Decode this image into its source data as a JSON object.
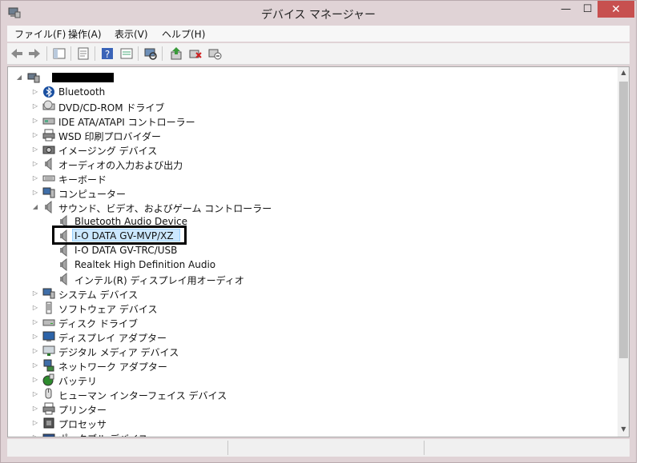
{
  "window": {
    "title": "デバイス マネージャー",
    "min_glyph": "—",
    "max_glyph": "☐",
    "close_glyph": "✕"
  },
  "menu": [
    {
      "label": "ファイル(F)"
    },
    {
      "label": "操作(A)"
    },
    {
      "label": "表示(V)"
    },
    {
      "label": "ヘルプ(H)"
    }
  ],
  "toolbar": [
    "back-icon",
    "forward-icon",
    "show-hide-tree-icon",
    "properties-icon",
    "help-icon",
    "view-icon",
    "scan-hardware-icon",
    "update-driver-icon",
    "uninstall-icon",
    "disable-device-icon"
  ],
  "tree": {
    "root_label_redacted": true,
    "items": [
      {
        "label": "Bluetooth",
        "icon": "bluetooth-icon",
        "expand": "collapsed"
      },
      {
        "label": "DVD/CD-ROM ドライブ",
        "icon": "dvd-drive-icon",
        "expand": "collapsed"
      },
      {
        "label": "IDE ATA/ATAPI コントローラー",
        "icon": "ide-controller-icon",
        "expand": "collapsed"
      },
      {
        "label": "WSD 印刷プロバイダー",
        "icon": "printer-icon",
        "expand": "collapsed"
      },
      {
        "label": "イメージング デバイス",
        "icon": "camera-icon",
        "expand": "collapsed"
      },
      {
        "label": "オーディオの入力および出力",
        "icon": "speaker-icon",
        "expand": "collapsed"
      },
      {
        "label": "キーボード",
        "icon": "keyboard-icon",
        "expand": "collapsed"
      },
      {
        "label": "コンピューター",
        "icon": "computer-icon",
        "expand": "collapsed"
      },
      {
        "label": "サウンド、ビデオ、およびゲーム コントローラー",
        "icon": "speaker-icon",
        "expand": "expanded"
      },
      {
        "label": "Bluetooth Audio Device",
        "icon": "speaker-icon",
        "child": true
      },
      {
        "label": "I-O DATA GV-MVP/XZ",
        "icon": "speaker-icon",
        "child": true,
        "selected": true
      },
      {
        "label": "I-O DATA GV-TRC/USB",
        "icon": "speaker-icon",
        "child": true
      },
      {
        "label": "Realtek High Definition Audio",
        "icon": "speaker-icon",
        "child": true
      },
      {
        "label": "インテル(R) ディスプレイ用オーディオ",
        "icon": "speaker-icon",
        "child": true
      },
      {
        "label": "システム デバイス",
        "icon": "system-icon",
        "expand": "collapsed"
      },
      {
        "label": "ソフトウェア デバイス",
        "icon": "software-device-icon",
        "expand": "collapsed"
      },
      {
        "label": "ディスク ドライブ",
        "icon": "disk-drive-icon",
        "expand": "collapsed"
      },
      {
        "label": "ディスプレイ アダプター",
        "icon": "monitor-icon",
        "expand": "collapsed"
      },
      {
        "label": "デジタル メディア デバイス",
        "icon": "media-device-icon",
        "expand": "collapsed"
      },
      {
        "label": "ネットワーク アダプター",
        "icon": "network-icon",
        "expand": "collapsed"
      },
      {
        "label": "バッテリ",
        "icon": "battery-icon",
        "expand": "collapsed"
      },
      {
        "label": "ヒューマン インターフェイス デバイス",
        "icon": "hid-icon",
        "expand": "collapsed"
      },
      {
        "label": "プリンター",
        "icon": "printer-icon",
        "expand": "collapsed"
      },
      {
        "label": "プロセッサ",
        "icon": "processor-icon",
        "expand": "collapsed"
      },
      {
        "label": "ポータブル デバイス",
        "icon": "portable-device-icon",
        "expand": "collapsed"
      }
    ]
  },
  "colors": {
    "title_bar": "#e0d3d6",
    "close_button": "#c7504f",
    "selection_fill": "#cce8ff",
    "highlight_box": "#000000"
  }
}
